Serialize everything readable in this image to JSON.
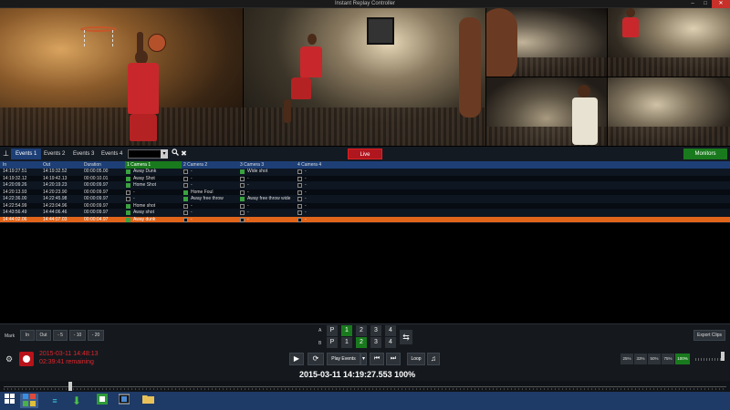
{
  "window": {
    "title": "Instant Replay Controller",
    "minimize": "–",
    "maximize": "□",
    "close": "✕"
  },
  "tabs": {
    "icon": "pin-icon",
    "items": [
      "Events 1",
      "Events 2",
      "Events 3",
      "Events 4"
    ],
    "active": 0,
    "search_icon": "search-icon",
    "clear_icon": "close-icon",
    "dropdown_glyph": "▾"
  },
  "live_label": "Live",
  "monitors_label": "Monitors",
  "grid": {
    "headers": {
      "in": "In",
      "out": "Out",
      "duration": "Duration",
      "cam1": "1 Camera 1",
      "cam2": "2 Camera 2",
      "cam3": "3 Camera 3",
      "cam4": "4 Camera 4"
    },
    "rows": [
      {
        "in": "14:19:27.51",
        "out": "14:19:32.52",
        "duration": "00:00:05.00",
        "c1": "Away Dunk",
        "c1on": true,
        "c2": "-",
        "c2on": false,
        "c3": "Wide shot",
        "c3on": true,
        "c4": "-",
        "c4on": false
      },
      {
        "in": "14:19:32.12",
        "out": "14:19:42.13",
        "duration": "00:00:10.01",
        "c1": "Away Shot",
        "c1on": true,
        "c2": "-",
        "c2on": false,
        "c3": "-",
        "c3on": false,
        "c4": "-",
        "c4on": false
      },
      {
        "in": "14:20:09.26",
        "out": "14:20:19.23",
        "duration": "00:00:09.97",
        "c1": "Home Shot",
        "c1on": true,
        "c2": "-",
        "c2on": false,
        "c3": "-",
        "c3on": false,
        "c4": "-",
        "c4on": false
      },
      {
        "in": "14:20:13.93",
        "out": "14:20:23.90",
        "duration": "00:00:09.97",
        "c1": "-",
        "c1on": false,
        "c2": "Home Foul",
        "c2on": true,
        "c3": "-",
        "c3on": false,
        "c4": "-",
        "c4on": false
      },
      {
        "in": "14:22:36.00",
        "out": "14:22:45.98",
        "duration": "00:00:09.97",
        "c1": "-",
        "c1on": false,
        "c2": "Away free throw",
        "c2on": true,
        "c3": "Away free throw wide",
        "c3on": true,
        "c4": "-",
        "c4on": false
      },
      {
        "in": "14:22:54.99",
        "out": "14:23:04.96",
        "duration": "00:00:09.97",
        "c1": "Home shot",
        "c1on": true,
        "c2": "-",
        "c2on": false,
        "c3": "-",
        "c3on": false,
        "c4": "-",
        "c4on": false
      },
      {
        "in": "14:43:56.49",
        "out": "14:44:06.46",
        "duration": "00:00:09.97",
        "c1": "Away shot",
        "c1on": true,
        "c2": "-",
        "c2on": false,
        "c3": "-",
        "c3on": false,
        "c4": "-",
        "c4on": false
      },
      {
        "in": "14:44:02.06",
        "out": "14:44:07.03",
        "duration": "00:00:04.97",
        "c1": "Away dunk",
        "c1on": true,
        "c2": "-",
        "c2on": false,
        "c3": "-",
        "c3on": false,
        "c4": "-",
        "c4on": false,
        "selected": true
      }
    ]
  },
  "mark": {
    "label": "Mark",
    "buttons": [
      "In",
      "Out",
      "- 5",
      "- 10",
      "- 20"
    ]
  },
  "cameras": {
    "rows": [
      {
        "label": "A",
        "p": "P",
        "nums": [
          "1",
          "2",
          "3",
          "4"
        ],
        "active": 0
      },
      {
        "label": "B",
        "p": "P",
        "nums": [
          "1",
          "2",
          "3",
          "4"
        ],
        "active": 1
      }
    ],
    "swap_icon": "swap-icon"
  },
  "export_label": "Export Clips",
  "recording": {
    "datetime": "2015-03-11 14:48:13",
    "remaining": "02:39:41 remaining",
    "settings_icon": "gear-icon",
    "record_icon": "record-icon"
  },
  "transport": {
    "play_icon": "play-icon",
    "replay_icon": "replay-icon",
    "play_events": "Play Events",
    "dropdown_glyph": "▾",
    "prev_icon": "skip-back-icon",
    "next_icon": "skip-forward-icon",
    "loop": "Loop",
    "music_icon": "music-icon",
    "timecode": "2015-03-11  14:19:27.553   100%"
  },
  "speeds": {
    "items": [
      "25%",
      "33%",
      "50%",
      "75%",
      "100%"
    ],
    "active": 4
  },
  "taskbar": {
    "icons": [
      "windows-start-icon",
      "app-grid-icon",
      "sort-icon",
      "download-icon",
      "vmix-icon",
      "film-icon",
      "folder-icon"
    ]
  },
  "colors": {
    "accent_blue": "#1d3f76",
    "accent_green": "#197a1d",
    "live_red": "#b0161e",
    "selected_row": "#e0641a",
    "record_text": "#e0262b"
  }
}
